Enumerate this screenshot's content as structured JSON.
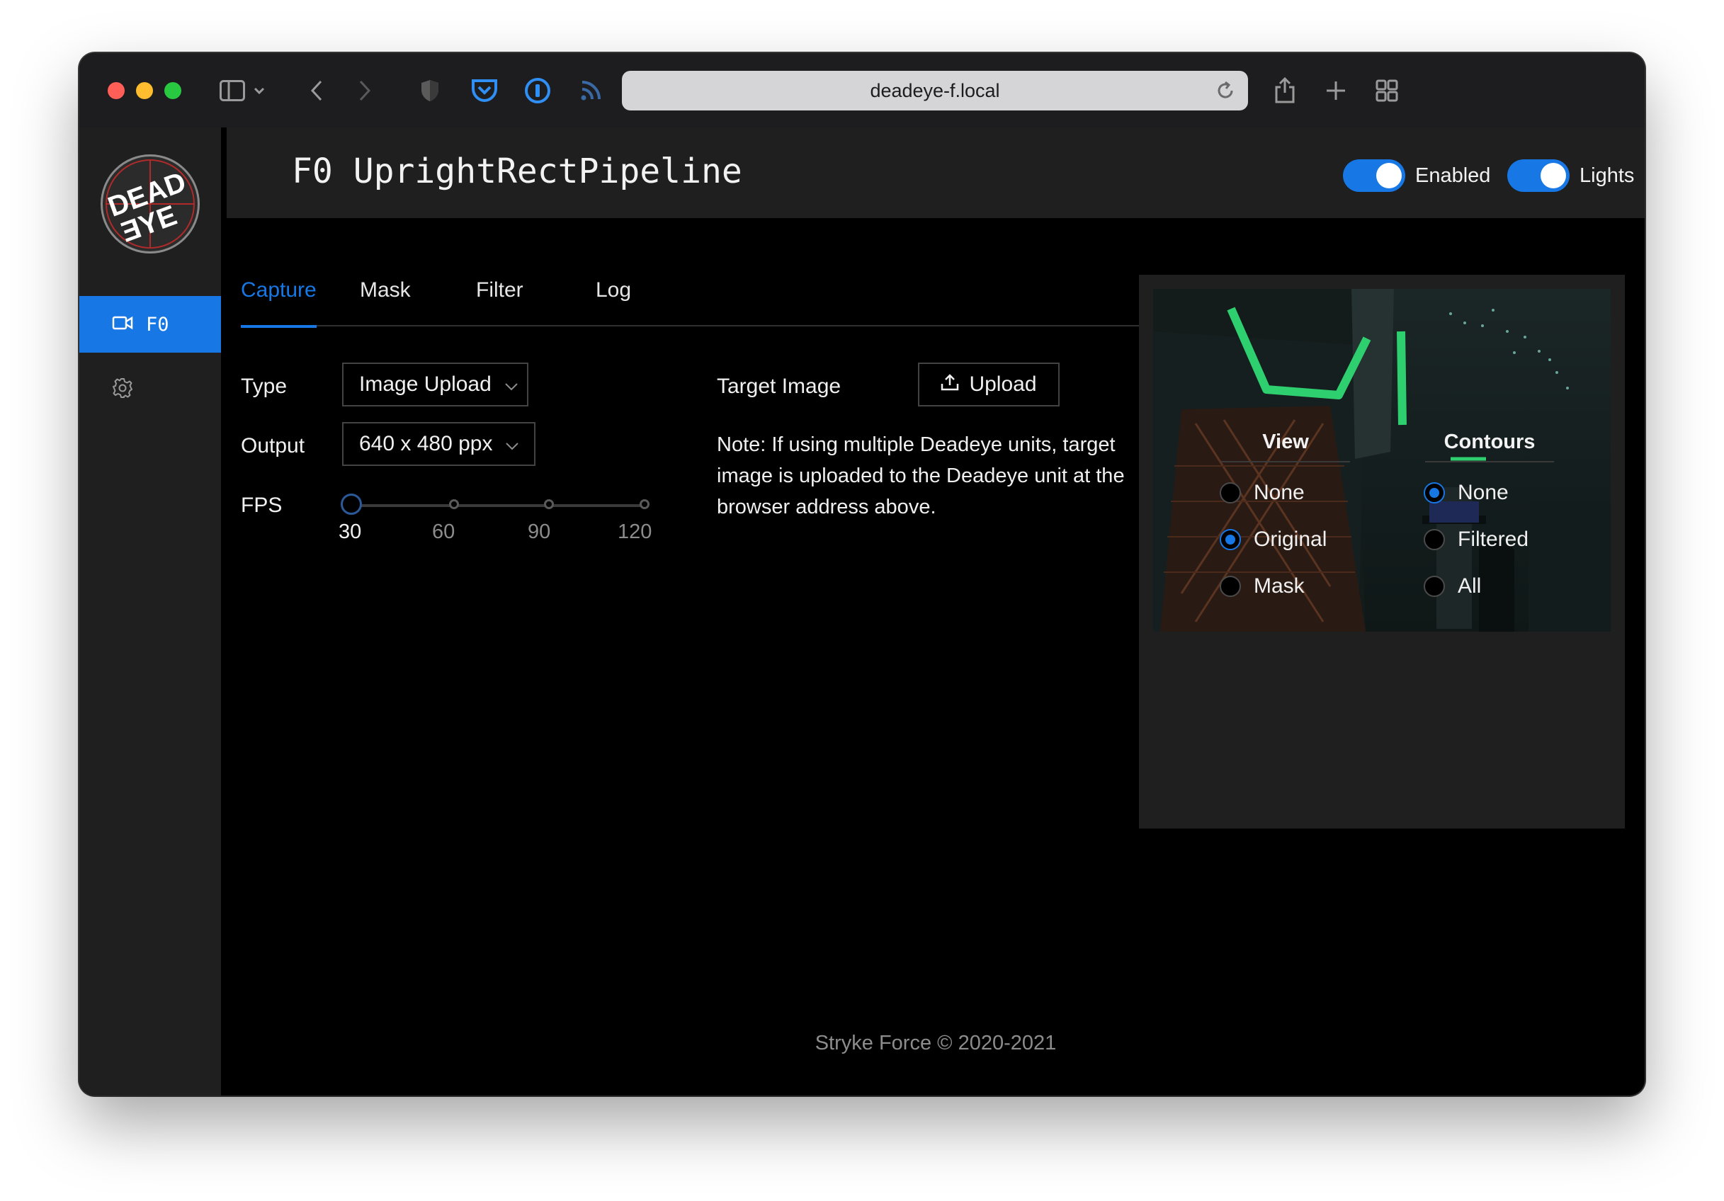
{
  "browser": {
    "url": "deadeye-f.local"
  },
  "sidebar": {
    "logo_text": "DEAD EYE",
    "items": [
      {
        "label": "F0",
        "icon": "video-camera-icon",
        "active": true
      },
      {
        "label": "",
        "icon": "gear-icon",
        "active": false
      }
    ]
  },
  "header": {
    "title": "F0 UprightRectPipeline",
    "toggles": [
      {
        "label": "Enabled",
        "on": true
      },
      {
        "label": "Lights",
        "on": true
      }
    ]
  },
  "tabs": [
    {
      "label": "Capture",
      "active": true
    },
    {
      "label": "Mask",
      "active": false
    },
    {
      "label": "Filter",
      "active": false
    },
    {
      "label": "Log",
      "active": false
    }
  ],
  "capture": {
    "type_label": "Type",
    "type_value": "Image Upload",
    "output_label": "Output",
    "output_value": "640 x 480 ppx",
    "fps_label": "FPS",
    "fps_marks": [
      "30",
      "60",
      "90",
      "120"
    ],
    "fps_value": 30,
    "target_label": "Target Image",
    "upload_label": "Upload",
    "note": "Note: If using multiple Deadeye units, target image is uploaded to the Deadeye unit at the browser address above."
  },
  "preview": {
    "view_title": "View",
    "view_options": [
      "None",
      "Original",
      "Mask"
    ],
    "view_selected": "Original",
    "contours_title": "Contours",
    "contours_options": [
      "None",
      "Filtered",
      "All"
    ],
    "contours_selected": "None"
  },
  "footer": "Stryke Force © 2020-2021",
  "colors": {
    "accent": "#1677e5",
    "background": "#000000",
    "panel": "#1f1f1f"
  }
}
